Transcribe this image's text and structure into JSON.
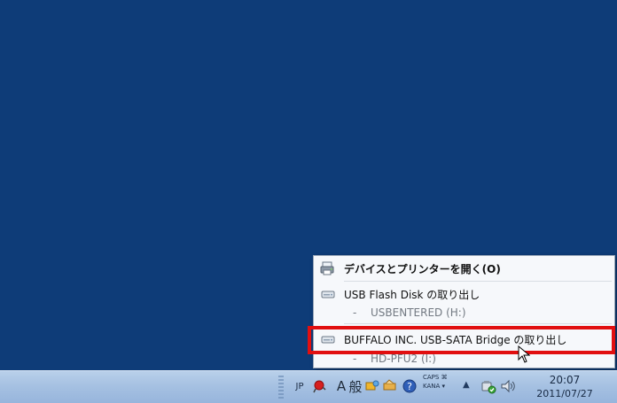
{
  "menu": {
    "devices_label": "デバイスとプリンターを開く(O)",
    "usb_flash_label": "USB Flash Disk の取り出し",
    "usb_flash_drive": "USBENTERED (H:)",
    "buffalo_label": "BUFFALO INC. USB-SATA Bridge の取り出し",
    "buffalo_drive": "HD-PFU2 (I:)",
    "dash": "-"
  },
  "taskbar": {
    "language": "JP",
    "ime_mode": "A",
    "ime_kanji": "般",
    "caps": "CAPS",
    "kana": "KANA",
    "time": "20:07",
    "date": "2011/07/27"
  },
  "icons": {
    "devices": "printer-icon",
    "drive": "drive-icon",
    "safe_remove": "safe-remove-icon",
    "speaker": "speaker-icon",
    "help": "help-icon"
  },
  "colors": {
    "desktop": "#0e3c78",
    "highlight": "#e10f10",
    "taskbar": "#a6c1e2"
  }
}
